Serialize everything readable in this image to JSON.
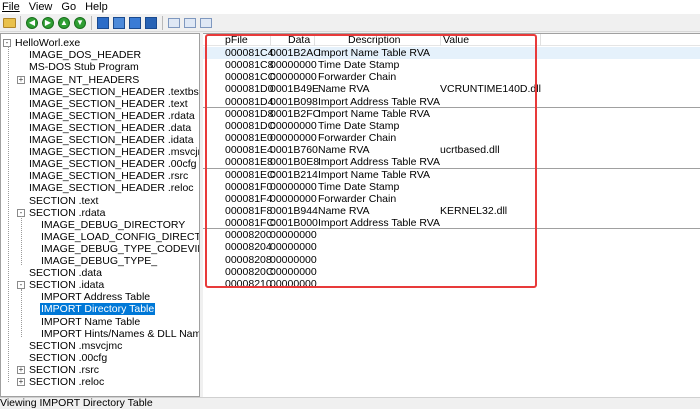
{
  "menu": [
    "File",
    "View",
    "Go",
    "Help"
  ],
  "toolbar": {
    "icons": [
      "open-folder-icon",
      "back-icon",
      "forward-icon",
      "up-icon",
      "refresh-icon",
      "save-icon",
      "export-icon",
      "import-icon",
      "list-view-icon",
      "tile-view-icon",
      "details-view-icon"
    ]
  },
  "tree": {
    "items": [
      {
        "label": "HelloWorl.exe",
        "exp": "-"
      },
      {
        "label": "IMAGE_DOS_HEADER"
      },
      {
        "label": "MS-DOS Stub Program"
      },
      {
        "label": "IMAGE_NT_HEADERS",
        "exp": "+"
      },
      {
        "label": "IMAGE_SECTION_HEADER .textbss"
      },
      {
        "label": "IMAGE_SECTION_HEADER .text"
      },
      {
        "label": "IMAGE_SECTION_HEADER .rdata"
      },
      {
        "label": "IMAGE_SECTION_HEADER .data"
      },
      {
        "label": "IMAGE_SECTION_HEADER .idata"
      },
      {
        "label": "IMAGE_SECTION_HEADER .msvcjmc"
      },
      {
        "label": "IMAGE_SECTION_HEADER .00cfg"
      },
      {
        "label": "IMAGE_SECTION_HEADER .rsrc"
      },
      {
        "label": "IMAGE_SECTION_HEADER .reloc"
      },
      {
        "label": "SECTION .text"
      },
      {
        "label": "SECTION .rdata",
        "exp": "-"
      },
      {
        "label": "IMAGE_DEBUG_DIRECTORY"
      },
      {
        "label": "IMAGE_LOAD_CONFIG_DIRECTORY"
      },
      {
        "label": "IMAGE_DEBUG_TYPE_CODEVIEW"
      },
      {
        "label": "IMAGE_DEBUG_TYPE_"
      },
      {
        "label": "SECTION .data"
      },
      {
        "label": "SECTION .idata",
        "exp": "-"
      },
      {
        "label": "IMPORT Address Table"
      },
      {
        "label": "IMPORT Directory Table",
        "selected": true
      },
      {
        "label": "IMPORT Name Table"
      },
      {
        "label": "IMPORT Hints/Names & DLL Names"
      },
      {
        "label": "SECTION .msvcjmc"
      },
      {
        "label": "SECTION .00cfg"
      },
      {
        "label": "SECTION .rsrc",
        "exp": "+"
      },
      {
        "label": "SECTION .reloc",
        "exp": "+"
      }
    ]
  },
  "table": {
    "columns": [
      "pFile",
      "Data",
      "Description",
      "Value"
    ],
    "rows": [
      [
        "000081C4",
        "0001B2AC",
        "Import Name Table RVA",
        ""
      ],
      [
        "000081C8",
        "00000000",
        "Time Date Stamp",
        ""
      ],
      [
        "000081CC",
        "00000000",
        "Forwarder Chain",
        ""
      ],
      [
        "000081D0",
        "0001B49E",
        "Name RVA",
        "VCRUNTIME140D.dll"
      ],
      [
        "000081D4",
        "0001B098",
        "Import Address Table RVA",
        ""
      ],
      [
        "000081D8",
        "0001B2FC",
        "Import Name Table RVA",
        ""
      ],
      [
        "000081DC",
        "00000000",
        "Time Date Stamp",
        ""
      ],
      [
        "000081E0",
        "00000000",
        "Forwarder Chain",
        ""
      ],
      [
        "000081E4",
        "0001B760",
        "Name RVA",
        "ucrtbased.dll"
      ],
      [
        "000081E8",
        "0001B0E8",
        "Import Address Table RVA",
        ""
      ],
      [
        "000081EC",
        "0001B214",
        "Import Name Table RVA",
        ""
      ],
      [
        "000081F0",
        "00000000",
        "Time Date Stamp",
        ""
      ],
      [
        "000081F4",
        "00000000",
        "Forwarder Chain",
        ""
      ],
      [
        "000081F8",
        "0001B944",
        "Name RVA",
        "KERNEL32.dll"
      ],
      [
        "000081FC",
        "0001B000",
        "Import Address Table RVA",
        ""
      ],
      [
        "00008200",
        "00000000",
        "",
        ""
      ],
      [
        "00008204",
        "00000000",
        "",
        ""
      ],
      [
        "00008208",
        "00000000",
        "",
        ""
      ],
      [
        "0000820C",
        "00000000",
        "",
        ""
      ],
      [
        "00008210",
        "00000000",
        "",
        ""
      ]
    ]
  },
  "status": "Viewing IMPORT Directory Table",
  "colors": {
    "selection": "#0078d7",
    "highlight_box": "#e83a3a"
  }
}
